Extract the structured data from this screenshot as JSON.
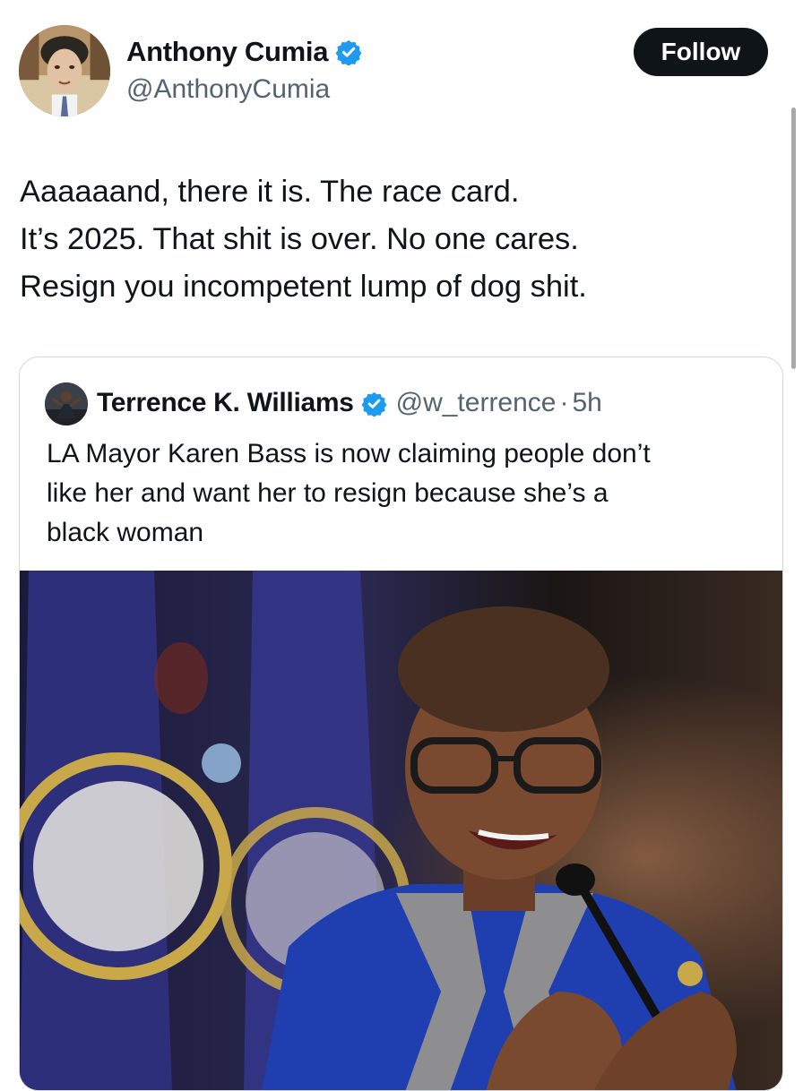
{
  "author": {
    "name": "Anthony Cumia",
    "handle": "@AnthonyCumia",
    "verified": true,
    "avatar_icon": "caricature-avatar"
  },
  "follow_button": {
    "label": "Follow"
  },
  "tweet": {
    "lines": [
      "Aaaaaand, there it is. The race card.",
      "It’s 2025. That shit is over. No one cares.",
      "Resign you incompetent lump of dog shit."
    ]
  },
  "quoted_tweet": {
    "name": "Terrence K. Williams",
    "handle": "@w_terrence",
    "separator": "·",
    "time": "5h",
    "verified": true,
    "lines": [
      "LA Mayor Karen Bass is now claiming people don’t",
      "like her and want her to resign because she’s a",
      "black woman"
    ],
    "image_description_icon": "press-photo"
  },
  "colors": {
    "text": "#0f1419",
    "secondary_text": "#536471",
    "verified_blue": "#1d9bf0",
    "follow_bg": "#0f1419",
    "border": "#cfd9de"
  }
}
